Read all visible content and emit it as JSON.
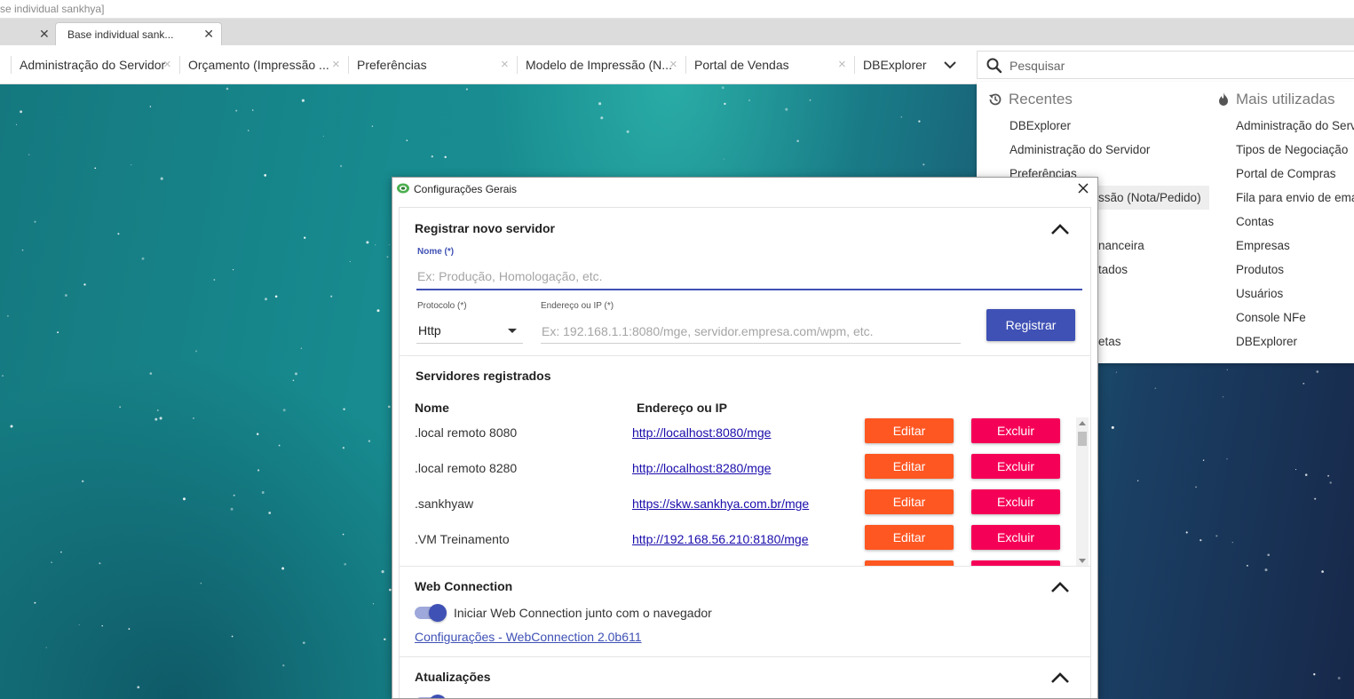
{
  "window": {
    "title_text": "se individual sankhya]"
  },
  "browser_tabs": {
    "active_label": "Base individual sank..."
  },
  "app_tabs": [
    {
      "label": "Administração do Servidor"
    },
    {
      "label": "Orçamento (Impressão ..."
    },
    {
      "label": "Preferências"
    },
    {
      "label": "Modelo de Impressão (N..."
    },
    {
      "label": "Portal de Vendas"
    },
    {
      "label": "DBExplorer"
    }
  ],
  "search": {
    "placeholder": "Pesquisar",
    "recent_title": "Recentes",
    "most_used_title": "Mais utilizadas",
    "recent": [
      "DBExplorer",
      "Administração do Servidor",
      "Preferências",
      "Orçamento (Impressão (Nota/Pedido)",
      "",
      "Movimentação Financeira",
      "Portal de Resultados",
      "",
      "",
      "Portal de Etiquetas"
    ],
    "recent_visible": [
      "DBExplorer",
      "Administração do Servidor",
      "Preferências",
      "ssão (Nota/Pedido)",
      "",
      "nanceira",
      "tados",
      "",
      "",
      "etas"
    ],
    "most_used": [
      "Administração do Servi",
      "Tipos de Negociação",
      "Portal de Compras",
      "Fila para envio de ema",
      "Contas",
      "Empresas",
      "Produtos",
      "Usuários",
      "Console NFe",
      "DBExplorer"
    ]
  },
  "dialog": {
    "title": "Configurações Gerais",
    "register": {
      "title": "Registrar novo servidor",
      "name_label": "Nome (*)",
      "name_placeholder": "Ex: Produção, Homologação, etc.",
      "protocol_label": "Protocolo (*)",
      "protocol_value": "Http",
      "address_label": "Endereço ou IP (*)",
      "address_placeholder": "Ex: 192.168.1.1:8080/mge, servidor.empresa.com/wpm, etc.",
      "submit_label": "Registrar"
    },
    "servers": {
      "title": "Servidores registrados",
      "col_name": "Nome",
      "col_address": "Endereço ou IP",
      "edit_label": "Editar",
      "delete_label": "Excluir",
      "rows": [
        {
          "name": ".local remoto 8080",
          "address": "http://localhost:8080/mge"
        },
        {
          "name": ".local remoto 8280",
          "address": "http://localhost:8280/mge"
        },
        {
          "name": ".sankhyaw",
          "address": "https://skw.sankhya.com.br/mge"
        },
        {
          "name": ".VM Treinamento",
          "address": "http://192.168.56.210:8180/mge"
        }
      ]
    },
    "web_connection": {
      "title": "Web Connection",
      "toggle_label": "Iniciar Web Connection junto com o navegador",
      "settings_link": "Configurações - WebConnection 2.0b611"
    },
    "updates": {
      "title": "Atualizações"
    }
  },
  "colors": {
    "primary": "#3f51b5",
    "edit": "#ff5722",
    "delete": "#f50057",
    "link": "#1a0dab"
  }
}
